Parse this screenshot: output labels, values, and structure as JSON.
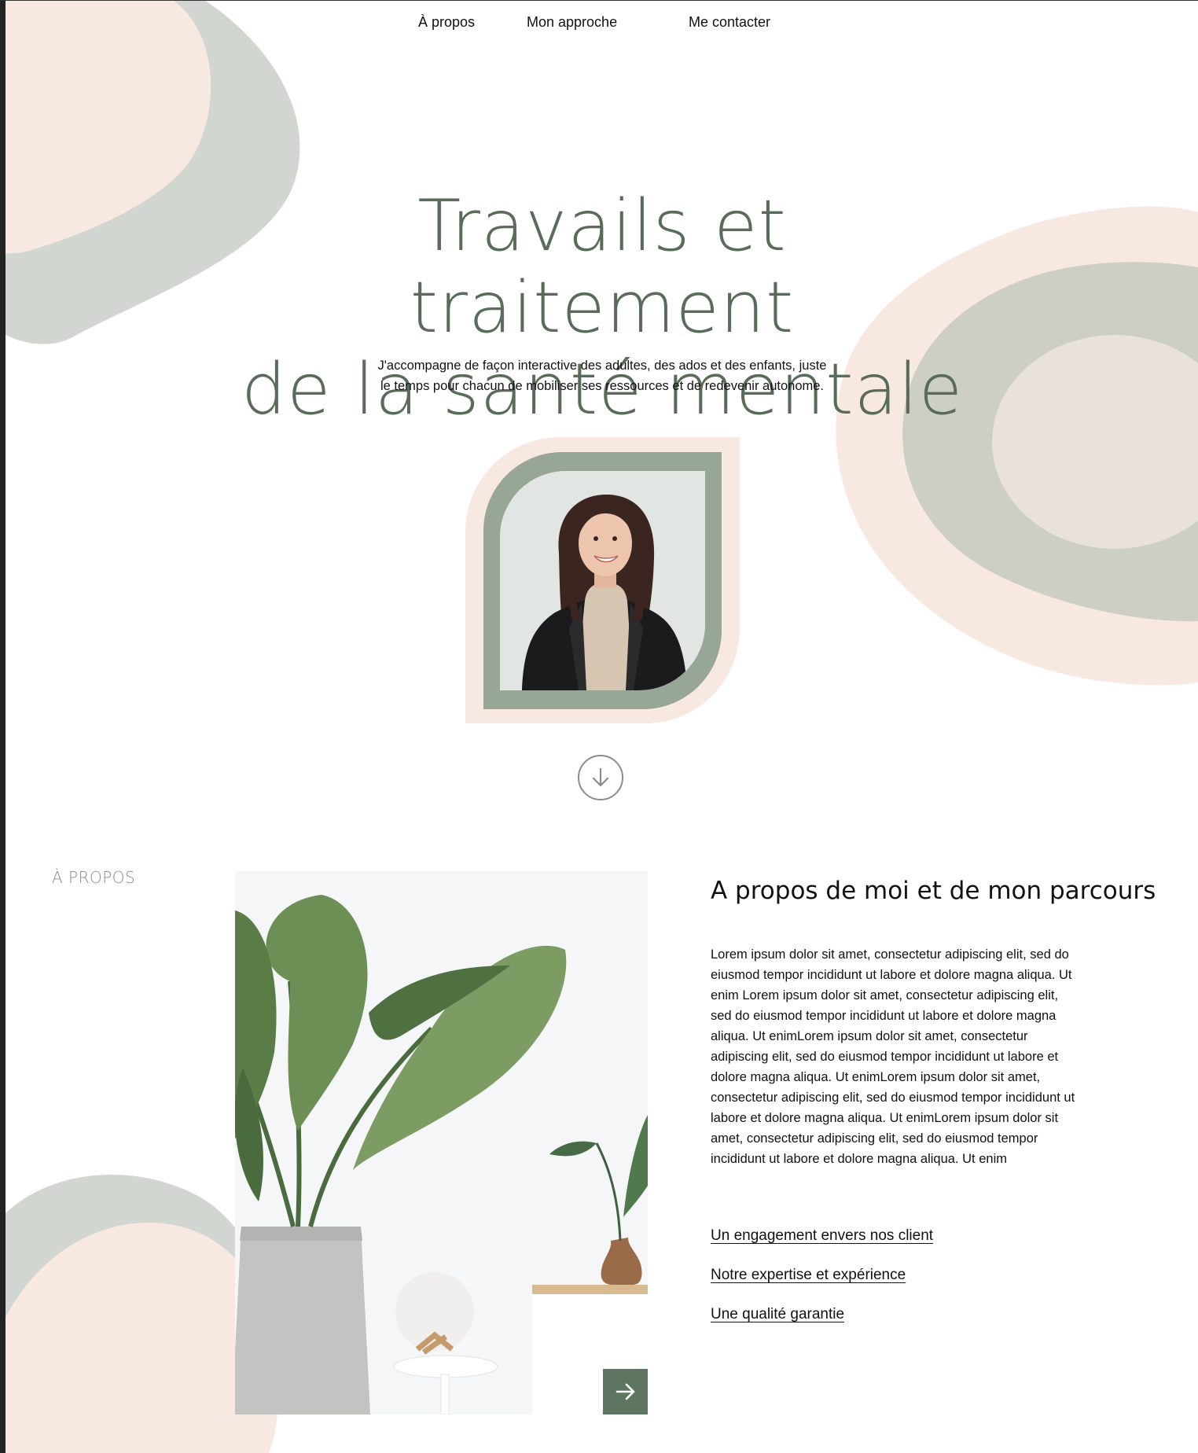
{
  "nav": {
    "items": [
      {
        "label": "À propos"
      },
      {
        "label": "Mon approche"
      },
      {
        "label": "Me contacter"
      }
    ]
  },
  "hero": {
    "title_line1": "Travails et traitement",
    "title_line2": "de la santé mentale",
    "subtitle": "J'accompagne de façon interactive des adultes, des ados et des enfants, juste le temps pour chacun de mobiliser ses ressources et de redevenir autonome."
  },
  "about": {
    "section_label": "À PROPOS",
    "title": "A propos de moi et de mon parcours",
    "body": "Lorem ipsum dolor sit amet, consectetur adipiscing elit, sed do eiusmod tempor incididunt ut labore et dolore magna aliqua. Ut enim Lorem ipsum dolor sit amet, consectetur adipiscing elit, sed do eiusmod tempor incididunt ut labore et dolore magna aliqua. Ut enimLorem ipsum dolor sit amet, consectetur adipiscing elit, sed do eiusmod tempor incididunt ut labore et dolore magna aliqua. Ut enimLorem ipsum dolor sit amet, consectetur adipiscing elit, sed do eiusmod tempor incididunt ut labore et dolore magna aliqua. Ut enimLorem ipsum dolor sit amet, consectetur adipiscing elit, sed do eiusmod tempor incididunt ut labore et dolore magna aliqua. Ut enim",
    "links": [
      {
        "label": "Un engagement envers nos client"
      },
      {
        "label": "Notre expertise et expérience"
      },
      {
        "label": "Une qualité garantie"
      }
    ]
  },
  "icons": {
    "scroll_down": "arrow-down-circle-icon",
    "next": "arrow-right-icon"
  },
  "colors": {
    "sage_dark": "#586c58",
    "sage": "#98a697",
    "sage_light": "#d1d6d0",
    "blush": "#f8e8e2",
    "button": "#5e7561"
  }
}
